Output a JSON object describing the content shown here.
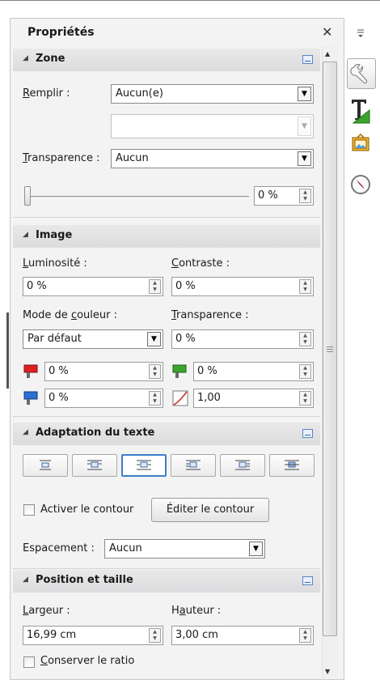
{
  "panel": {
    "title": "Propriétés"
  },
  "zone": {
    "heading": "Zone",
    "fill_label_u": "R",
    "fill_label_rest": "emplir :",
    "fill_value": "Aucun(e)",
    "fill_secondary_value": "",
    "transparency_label_u": "T",
    "transparency_label_rest": "ransparence :",
    "transparency_value": "Aucun",
    "transparency_percent": "0 %",
    "slider_level_percent": 0
  },
  "image": {
    "heading": "Image",
    "brightness_label_u": "L",
    "brightness_label_rest": "uminosité :",
    "brightness_value": "0 %",
    "contrast_label_u": "C",
    "contrast_label_rest": "ontraste :",
    "contrast_value": "0 %",
    "color_mode_label_pre": "Mode de ",
    "color_mode_label_u": "c",
    "color_mode_label_rest": "ouleur :",
    "color_mode_value": "Par défaut",
    "transparency_label_u": "T",
    "transparency_label_rest": "ransparence :",
    "transparency_value": "0 %",
    "red_value": "0 %",
    "green_value": "0 %",
    "blue_value": "0 %",
    "gamma_value": "1,00"
  },
  "text_wrap": {
    "heading": "Adaptation du texte",
    "enable_contour_label": "Activer le contour",
    "edit_contour_button": "Éditer le contour",
    "spacing_label": "Espacement :",
    "spacing_value": "Aucun",
    "selected_mode_index": 2
  },
  "position_size": {
    "heading": "Position et taille",
    "width_label_u": "L",
    "width_label_rest": "argeur :",
    "width_value": "16,99 cm",
    "height_label_pre": "H",
    "height_label_u": "a",
    "height_label_rest": "uteur :",
    "height_value": "3,00 cm",
    "keep_ratio_label_u": "C",
    "keep_ratio_label_rest": "onserver le ratio"
  },
  "colors": {
    "accent": "#3c7fc8",
    "red_channel": "#e02020",
    "green_channel": "#3aa52c",
    "blue_channel": "#2a6fd4"
  }
}
